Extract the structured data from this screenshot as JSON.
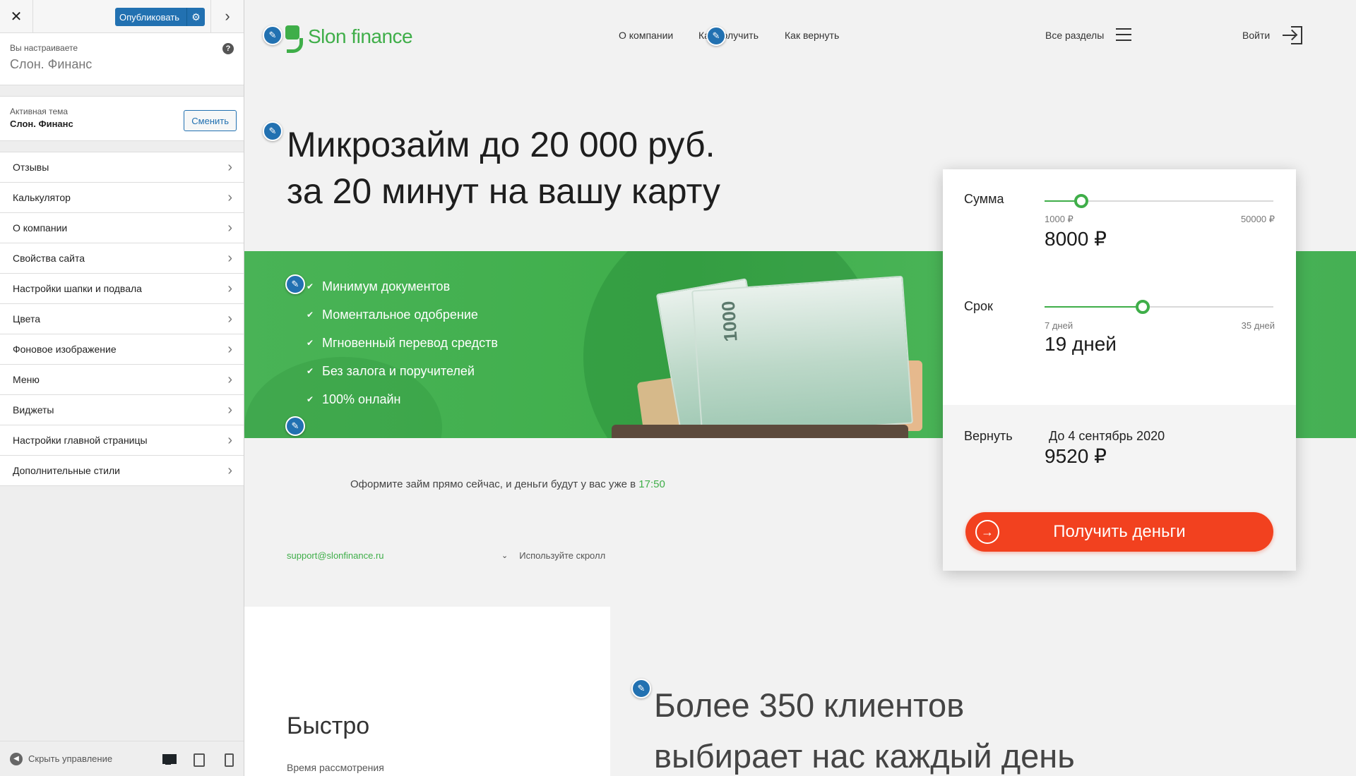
{
  "customizer": {
    "close_icon": "close-icon",
    "publish_label": "Опубликовать",
    "customizing_label": "Вы настраиваете",
    "site_name": "Слон. Финанс",
    "active_theme_label": "Активная тема",
    "active_theme_name": "Слон. Финанс",
    "change_label": "Сменить",
    "sections": [
      {
        "label": "Отзывы"
      },
      {
        "label": "Калькулятор"
      },
      {
        "label": "О компании"
      },
      {
        "label": "Свойства сайта"
      },
      {
        "label": "Настройки шапки и подвала"
      },
      {
        "label": "Цвета"
      },
      {
        "label": "Фоновое изображение"
      },
      {
        "label": "Меню"
      },
      {
        "label": "Виджеты"
      },
      {
        "label": "Настройки главной страницы"
      },
      {
        "label": "Дополнительные стили"
      }
    ],
    "hide_controls_label": "Скрыть управление"
  },
  "site": {
    "logo_text": "Slon finance",
    "nav": {
      "about": "О компании",
      "get": "Как получить",
      "return": "Как вернуть",
      "all_sections": "Все разделы",
      "login": "Войти"
    },
    "hero": {
      "line1": "Микрозайм до 20 000 руб.",
      "line2": "за 20 минут на вашу карту"
    },
    "features": [
      "Минимум документов",
      "Моментальное одобрение",
      "Мгновенный перевод средств",
      "Без залога и поручителей",
      "100% онлайн"
    ],
    "bill_number": "1000",
    "calculator": {
      "amount_label": "Сумма",
      "amount_min": "1000 ₽",
      "amount_max": "50000 ₽",
      "amount_value": "8000 ₽",
      "amount_fraction": 0.16,
      "term_label": "Срок",
      "term_min": "7 дней",
      "term_max": "35 дней",
      "term_value": "19 дней",
      "term_fraction": 0.43,
      "return_label": "Вернуть",
      "return_date": "До 4 сентябрь 2020",
      "return_value": "9520 ₽",
      "cta_label": "Получить деньги"
    },
    "offer_text": "Оформите займ прямо сейчас, и деньги будут у вас уже в ",
    "offer_time": "17:50",
    "support_email": "support@slonfinance.ru",
    "scroll_hint": "Используйте скролл",
    "fast_title": "Быстро",
    "fast_sub": "Время рассмотрения",
    "clients_line1": "Более 350 клиентов",
    "clients_line2": "выбирает нас каждый день"
  },
  "colors": {
    "brand_green": "#3fae49",
    "cta_red": "#f2411f",
    "wp_blue": "#2271b1"
  }
}
